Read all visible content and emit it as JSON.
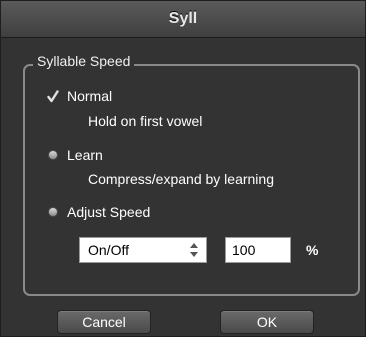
{
  "window": {
    "title": "Syll"
  },
  "group": {
    "title": "Syllable Speed",
    "options": [
      {
        "label": "Normal",
        "description": "Hold on first vowel",
        "selected": true
      },
      {
        "label": "Learn",
        "description": "Compress/expand by learning",
        "selected": false
      },
      {
        "label": "Adjust Speed",
        "description": "",
        "selected": false
      }
    ],
    "adjust": {
      "mode_value": "On/Off",
      "speed_value": "100",
      "unit": "%"
    }
  },
  "buttons": {
    "cancel": "Cancel",
    "ok": "OK"
  },
  "colors": {
    "background": "#333333",
    "titlebar": "#4a4a4a",
    "group_border": "#8a8a8a",
    "text": "#ffffff"
  },
  "icons": {
    "selected_radio": "checkmark-icon",
    "unselected_radio": "radio-dot-icon",
    "select_arrows": "up-down-arrows-icon"
  }
}
